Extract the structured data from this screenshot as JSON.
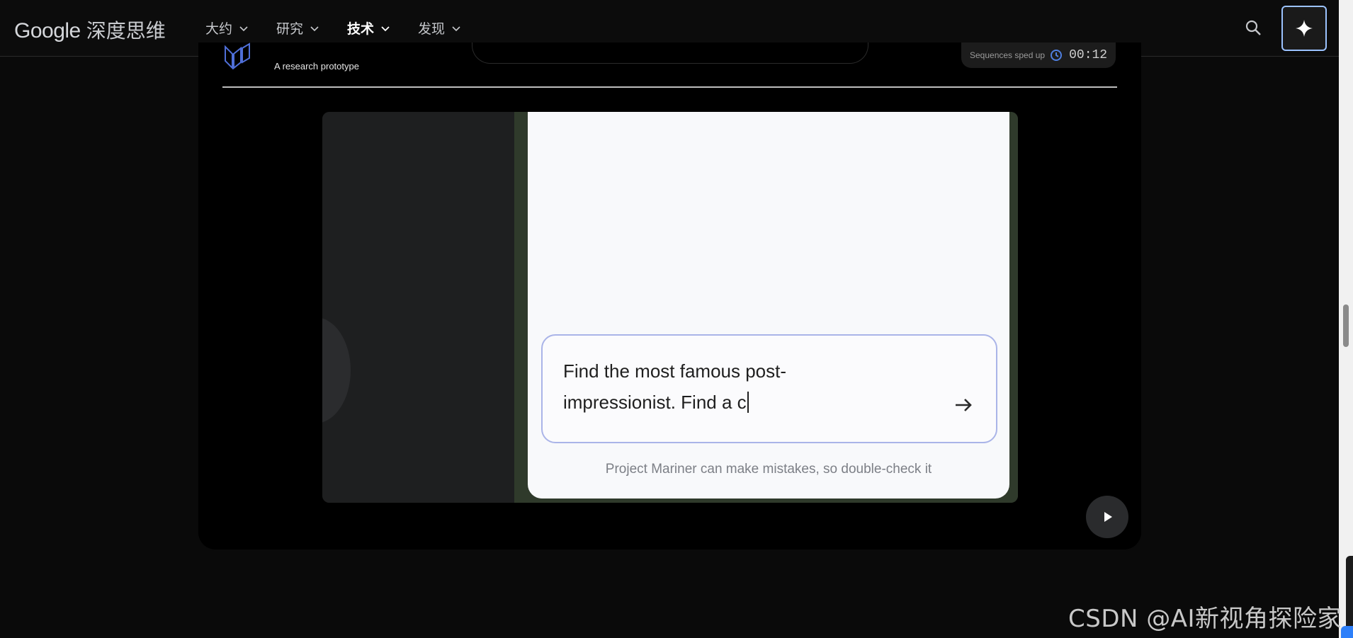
{
  "nav": {
    "logo_google": "Google",
    "logo_product": "深度思维",
    "items": [
      {
        "label": "大约",
        "active": false
      },
      {
        "label": "研究",
        "active": false
      },
      {
        "label": "技术",
        "active": true
      },
      {
        "label": "发现",
        "active": false
      }
    ],
    "search_icon": "search-icon",
    "spark_icon": "sparkle-icon"
  },
  "card": {
    "subtitle": "A research prototype",
    "speed_text": "Sequences sped up",
    "timer": "00:12"
  },
  "video": {
    "prompt_line1": "Find the most famous post-",
    "prompt_line2": "impressionist. Find a c",
    "disclaimer": "Project Mariner can make mistakes, so double-check it",
    "send_icon": "arrow-right-icon",
    "play_icon": "play-icon"
  },
  "watermark": "CSDN @AI新视角探险家",
  "colors": {
    "accent_border": "#9cc3ff",
    "prompt_border": "#aab4e8",
    "background": "#0a0a0a"
  }
}
